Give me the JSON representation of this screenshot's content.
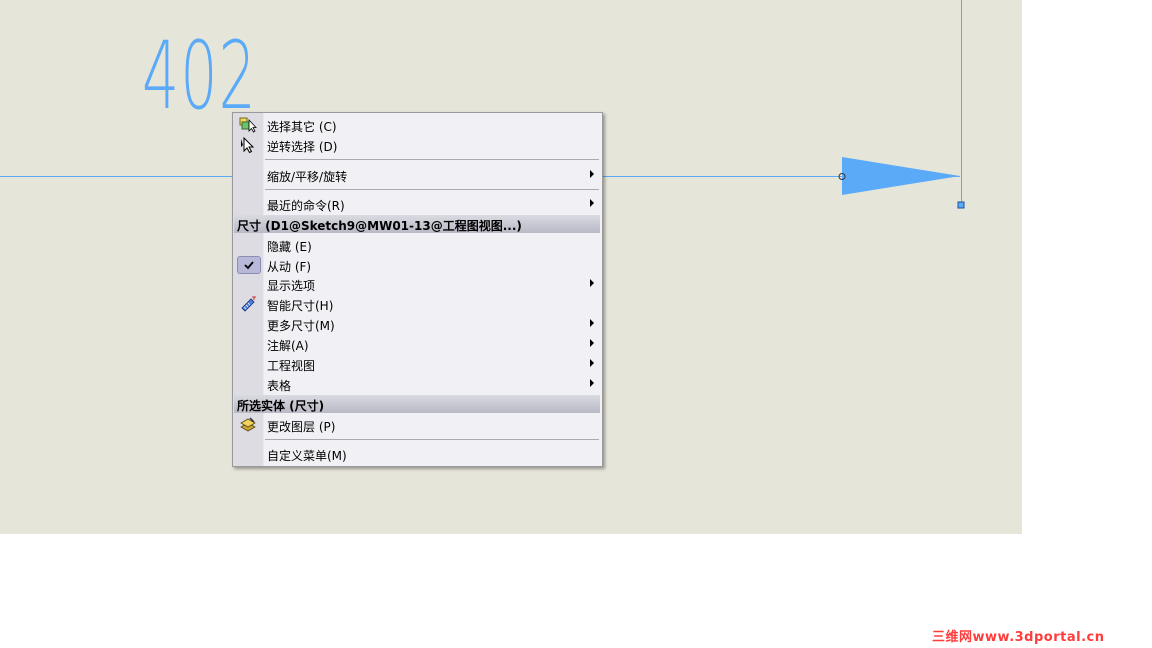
{
  "drawing": {
    "dimension_value": "402"
  },
  "context_menu": {
    "items_top": [
      {
        "label": "选择其它 (C)",
        "icon": "select-other-icon"
      },
      {
        "label": "逆转选择 (D)",
        "icon": "invert-selection-cursor-icon"
      }
    ],
    "zoom_pan_rotate": "缩放/平移/旋转",
    "recent_commands": "最近的命令(R)",
    "section_dimension_header": "尺寸 (D1@Sketch9@MW01-13@工程图视图...)",
    "dimension_items": [
      {
        "label": "隐藏 (E)"
      },
      {
        "label": "从动 (F)",
        "checked": true
      },
      {
        "label": "显示选项",
        "submenu": true
      },
      {
        "label": "智能尺寸(H)",
        "icon": "smart-dimension-icon"
      },
      {
        "label": "更多尺寸(M)",
        "submenu": true
      },
      {
        "label": "注解(A)",
        "submenu": true
      },
      {
        "label": "工程视图",
        "submenu": true
      },
      {
        "label": "表格",
        "submenu": true
      }
    ],
    "section_entity_header": "所选实体 (尺寸)",
    "change_layer": "更改图层 (P)",
    "customize_menu": "自定义菜单(M)"
  },
  "watermark": "三维网www.3dportal.cn",
  "colors": {
    "canvas": "#e6e5da",
    "dimension_blue": "#5aaaf8",
    "menu_bg": "#f1f1f5",
    "watermark_red": "#ff3c3c"
  }
}
